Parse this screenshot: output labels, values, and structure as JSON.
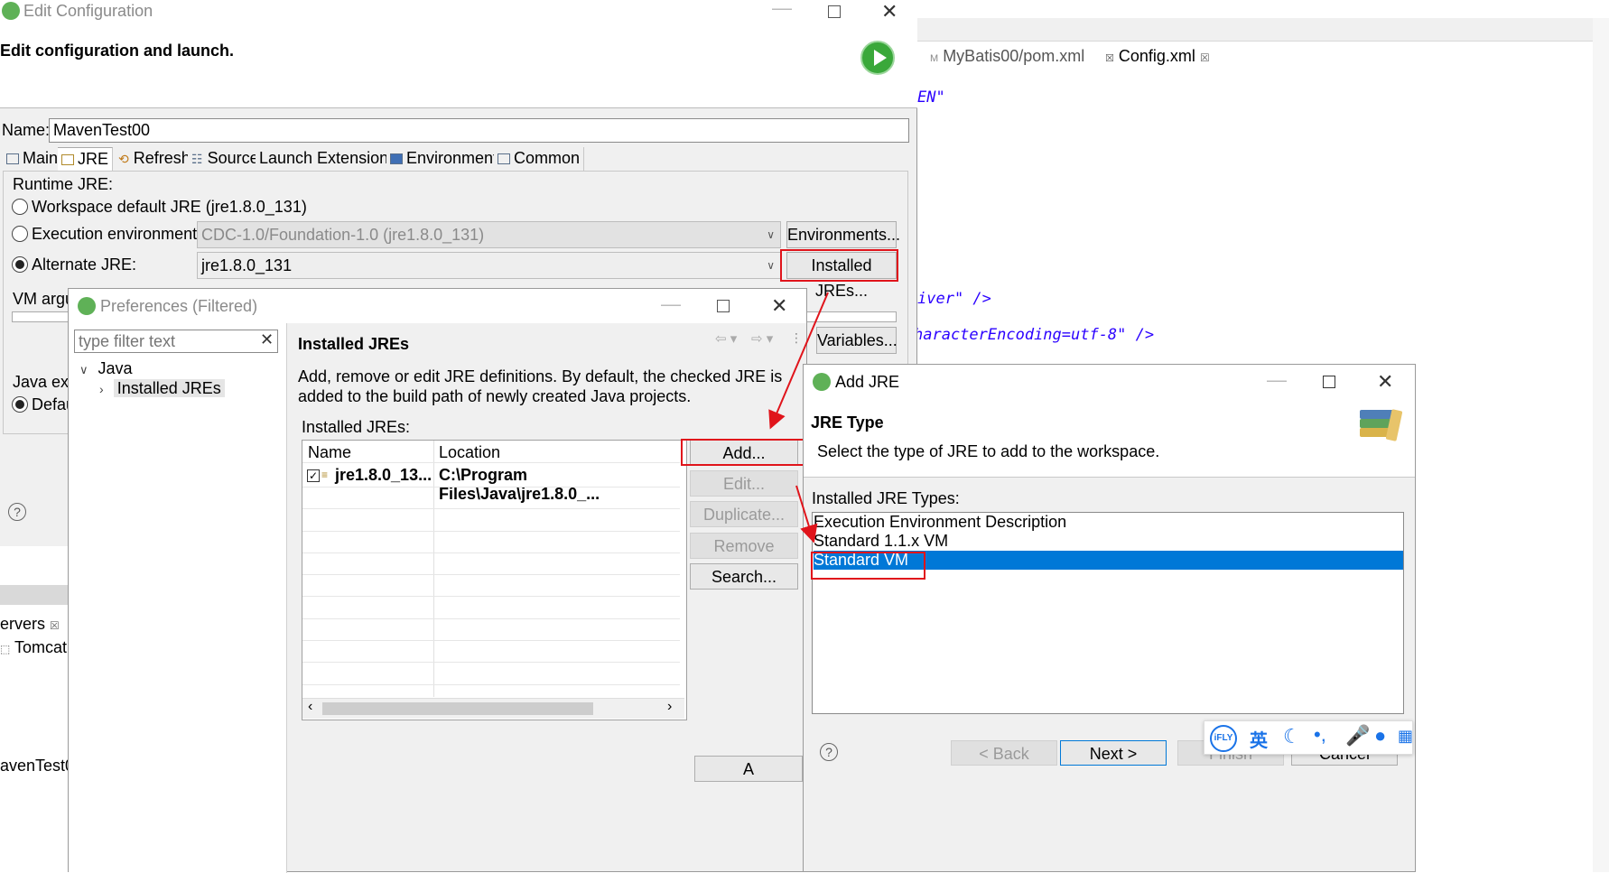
{
  "edit_config": {
    "title": "Edit Configuration",
    "heading": "Edit configuration and launch.",
    "name_label": "Name:",
    "name_value": "MavenTest00",
    "tabs": [
      {
        "label": "Main"
      },
      {
        "label": "JRE"
      },
      {
        "label": "Refresh"
      },
      {
        "label": "Source"
      },
      {
        "label": "Launch Extensions"
      },
      {
        "label": "Environment"
      },
      {
        "label": "Common"
      }
    ],
    "runtime_jre_label": "Runtime JRE:",
    "workspace_default": "Workspace default JRE (jre1.8.0_131)",
    "execution_env_label": "Execution environment:",
    "execution_env_value": "CDC-1.0/Foundation-1.0 (jre1.8.0_131)",
    "environments_button": "Environments...",
    "alternate_jre_label": "Alternate JRE:",
    "alternate_jre_value": "jre1.8.0_131",
    "installed_jres_button": "Installed JREs...",
    "vm_args_label": "VM argu",
    "variables_button": "Variables...",
    "java_exe_label": "Java exe",
    "default_label": "Defau",
    "help_icon": "?"
  },
  "editor": {
    "tab1": "MyBatis00/pom.xml",
    "tab2": "Config.xml",
    "code_line1": "EN\"",
    "code_line2": "iver\" />",
    "code_line3": "haracterEncoding=utf-8\" />",
    "servers_tab": "ervers",
    "servers_item": "Tomcat v",
    "bottom_text": "avenTest0"
  },
  "preferences": {
    "title": "Preferences (Filtered)",
    "filter_placeholder": "type filter text",
    "tree_java": "Java",
    "tree_installed_jres": "Installed JREs",
    "page_title": "Installed JREs",
    "description": "Add, remove or edit JRE definitions. By default, the checked JRE is added to the build path of newly created Java projects.",
    "table_label": "Installed JREs:",
    "col_name": "Name",
    "col_location": "Location",
    "row_name": "jre1.8.0_13...",
    "row_location": "C:\\Program Files\\Java\\jre1.8.0_...",
    "buttons": {
      "add": "Add...",
      "edit": "Edit...",
      "duplicate": "Duplicate...",
      "remove": "Remove",
      "search": "Search..."
    },
    "apply_partial": "A"
  },
  "add_jre": {
    "title": "Add JRE",
    "heading": "JRE Type",
    "subheading": "Select the type of JRE to add to the workspace.",
    "list_label": "Installed JRE Types:",
    "types": [
      "Execution Environment Description",
      "Standard 1.1.x VM",
      "Standard VM"
    ],
    "back_button": "< Back",
    "next_button": "Next >",
    "finish_button": "Finish",
    "cancel_button": "Cancel",
    "help_icon": "?"
  },
  "ime_toolbar": {
    "brand": "iFLY",
    "lang": "英"
  },
  "colors": {
    "selection": "#0078d7",
    "highlight": "#e0141b",
    "accent_green": "#3aa83a"
  }
}
